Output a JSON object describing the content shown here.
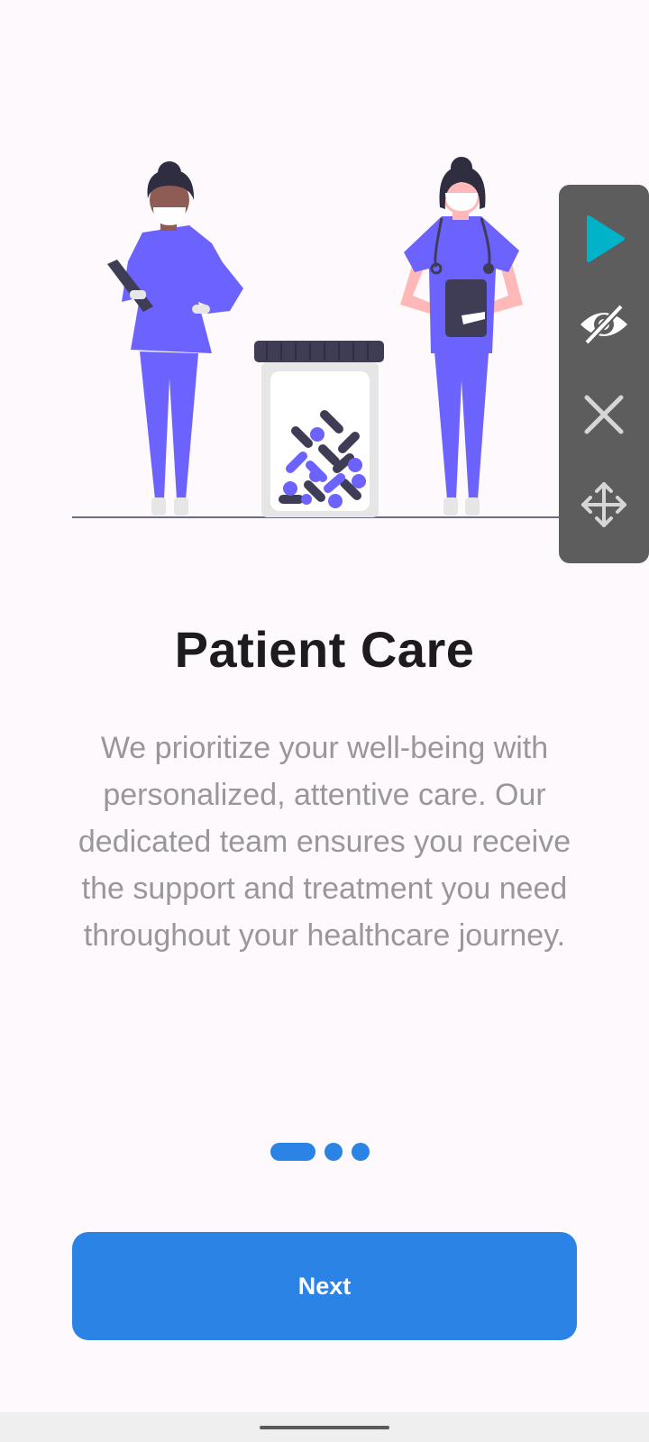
{
  "screen": {
    "title": "Patient Care",
    "description": "We prioritize your well-being with personalized, attentive care. Our dedicated team ensures you receive the support and treatment you need throughout your healthcare journey.",
    "next_label": "Next"
  },
  "pager": {
    "current_page": 1,
    "total_pages": 3
  },
  "floating_toolbar": {
    "buttons": [
      {
        "icon": "play-icon"
      },
      {
        "icon": "eye-off-icon"
      },
      {
        "icon": "close-icon"
      },
      {
        "icon": "move-icon"
      }
    ]
  },
  "colors": {
    "accent": "#2b83e6",
    "figure_purple": "#6c63ff",
    "background": "#fef9fc",
    "play_teal": "#00b3c8"
  }
}
